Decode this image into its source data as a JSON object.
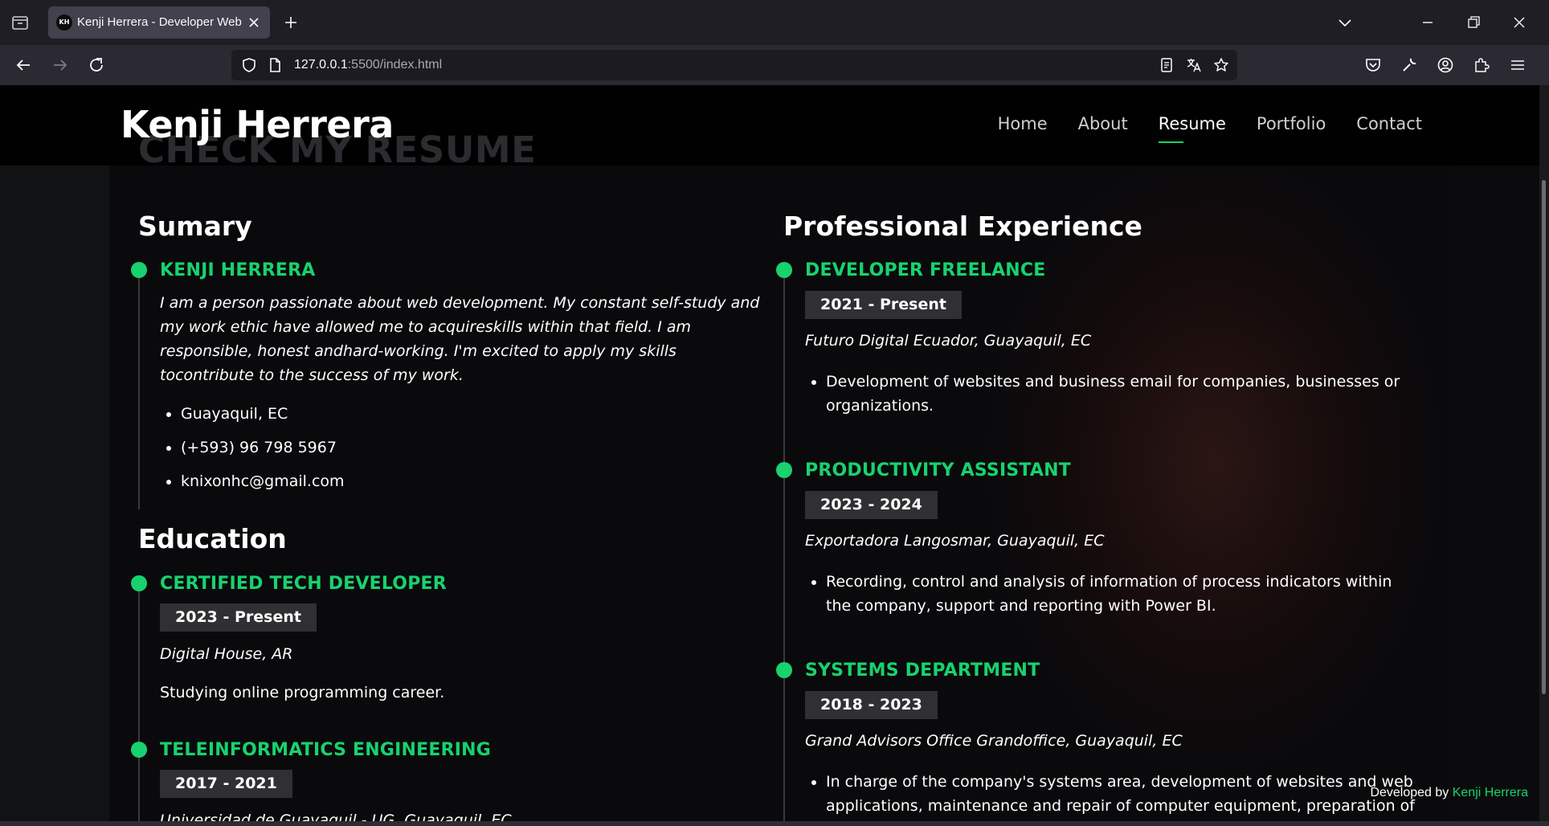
{
  "browser": {
    "tab_title": "Kenji Herrera - Developer Web",
    "tab_favicon": "KH",
    "url_host": "127.0.0.1",
    "url_rest": ":5500/index.html"
  },
  "header": {
    "logo": "Kenji Herrera",
    "ghost_title": "CHECK MY RESUME",
    "menu": [
      "Home",
      "About",
      "Resume",
      "Portfolio",
      "Contact"
    ],
    "active_item": "Resume"
  },
  "summary": {
    "heading": "Sumary",
    "name": "KENJI HERRERA",
    "text": "I am a person passionate about web development. My constant self-study and my work ethic have allowed me to acquireskills within that field. I am responsible, honest andhard-working. I'm excited to apply my skills tocontribute to the success of my work.",
    "contact": [
      "Guayaquil, EC",
      "(+593) 96 798 5967",
      "knixonhc@gmail.com"
    ]
  },
  "education": {
    "heading": "Education",
    "items": [
      {
        "title": "CERTIFIED TECH DEVELOPER",
        "years": "2023 - Present",
        "place": "Digital House, AR",
        "desc": "Studying online programming career."
      },
      {
        "title": "TELEINFORMATICS ENGINEERING",
        "years": "2017 - 2021",
        "place": "Universidad de Guayaquil - UG, Guayaquil, EC"
      }
    ]
  },
  "experience": {
    "heading": "Professional Experience",
    "items": [
      {
        "title": "DEVELOPER FREELANCE",
        "years": "2021 - Present",
        "place": "Futuro Digital Ecuador, Guayaquil, EC",
        "bullet": "Development of websites and business email for companies, businesses or organizations."
      },
      {
        "title": "PRODUCTIVITY ASSISTANT",
        "years": "2023 - 2024",
        "place": "Exportadora Langosmar, Guayaquil, EC",
        "bullet": "Recording, control and analysis of information of process indicators within the company, support and reporting with Power BI."
      },
      {
        "title": "SYSTEMS DEPARTMENT",
        "years": "2018 - 2023",
        "place": "Grand Advisors Office Grandoffice, Guayaquil, EC",
        "bullet": "In charge of the company's systems area, development of websites and web applications, maintenance and repair of computer equipment, preparation of"
      }
    ]
  },
  "footer": {
    "prefix": "Developed by ",
    "author": "Kenji Herrera"
  },
  "colors": {
    "accent": "#18d26e",
    "badge_bg": "#303033",
    "background": "#0a0a0c"
  }
}
